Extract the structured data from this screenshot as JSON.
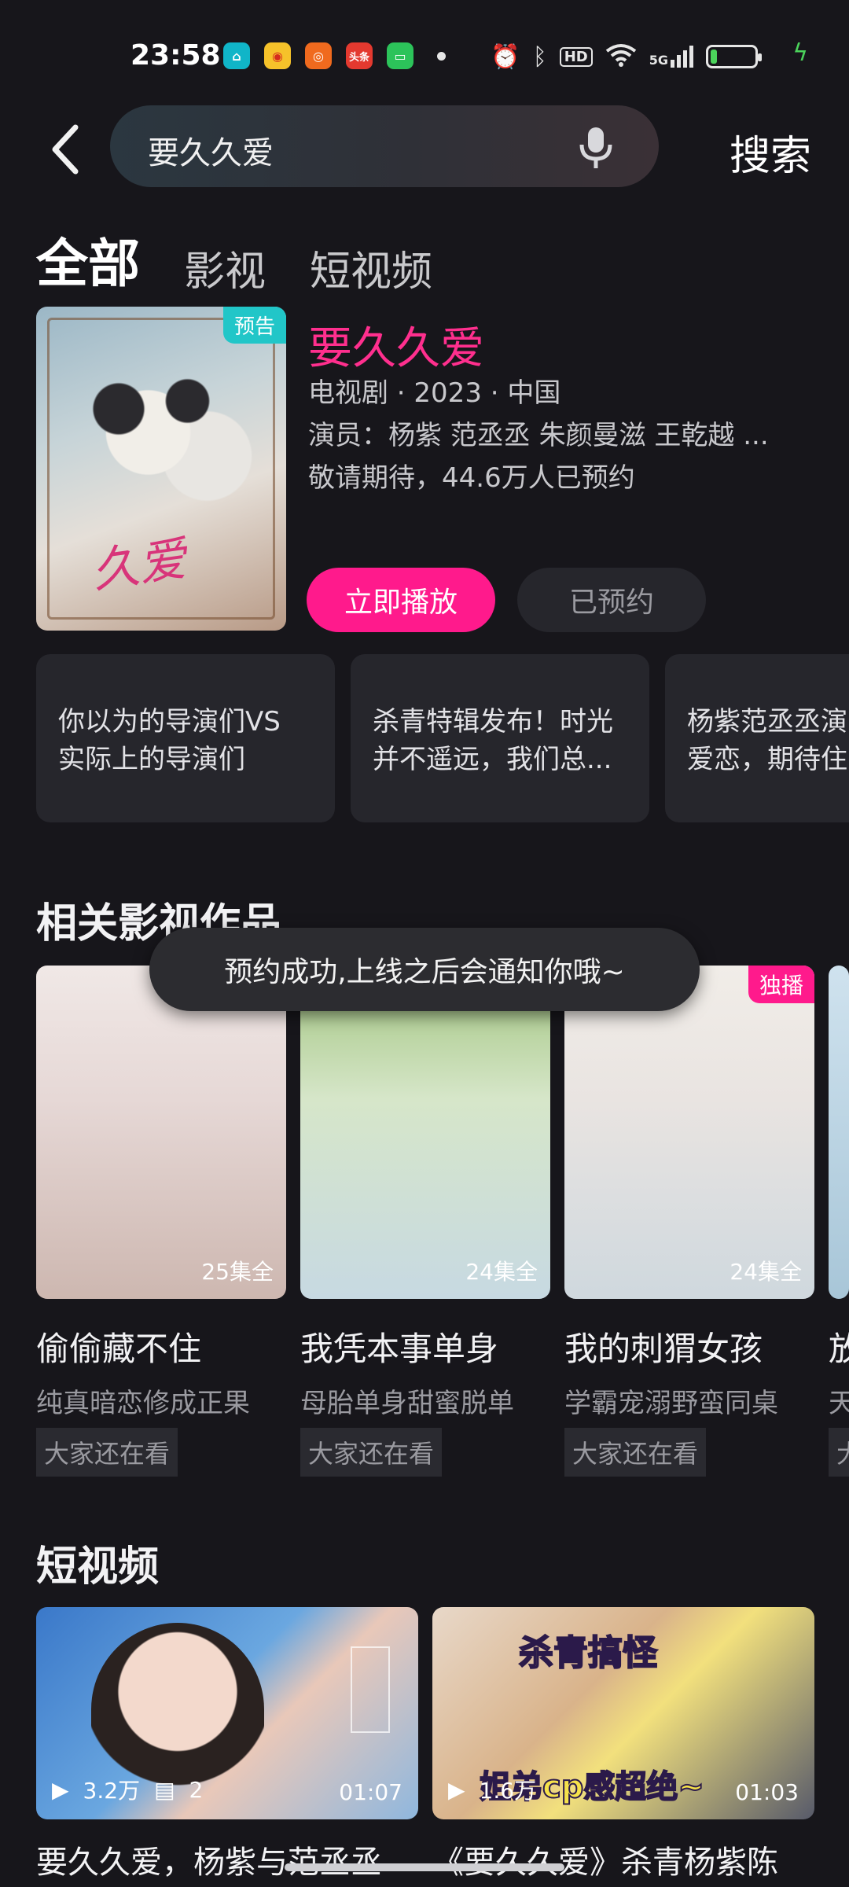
{
  "status_bar": {
    "time": "23:58",
    "apps": [
      "home-app",
      "weibo",
      "app-orange",
      "toutiao",
      "wechat-green"
    ],
    "toutiao_label": "头条",
    "icons": [
      "alarm-icon",
      "bluetooth-icon",
      "hd-icon",
      "wifi-icon",
      "5g-signal-icon",
      "battery-icon",
      "charging-icon"
    ],
    "hd_label": "HD",
    "signal_label": "5G"
  },
  "search": {
    "query": "要久久爱",
    "submit_label": "搜索"
  },
  "tabs": [
    {
      "label": "全部",
      "active": true
    },
    {
      "label": "影视",
      "active": false
    },
    {
      "label": "短视频",
      "active": false
    }
  ],
  "featured": {
    "badge": "预告",
    "title": "要久久爱",
    "meta": "电视剧 · 2023 · 中国",
    "cast": "演员：杨紫 范丞丞 朱颜曼滋 王乾越 ...",
    "status": "敬请期待，44.6万人已预约",
    "play_label": "立即播放",
    "booked_label": "已预约",
    "accent": "#ff1a8c"
  },
  "clips": [
    {
      "line1": "你以为的导演们VS",
      "line2": "实际上的导演们"
    },
    {
      "line1": "杀青特辑发布！时光",
      "line2": "并不遥远，我们总..."
    },
    {
      "line1": "杨紫范丞丞演",
      "line2": "爱恋，期待住"
    }
  ],
  "related_section": {
    "title": "相关影视作品",
    "items": [
      {
        "name": "偷偷藏不住",
        "desc": "纯真暗恋修成正果",
        "episodes": "25集全",
        "tag": "大家还在看"
      },
      {
        "name": "我凭本事单身",
        "desc": "母胎单身甜蜜脱单",
        "episodes": "24集全",
        "tag": "大家还在看"
      },
      {
        "name": "我的刺猬女孩",
        "desc": "学霸宠溺野蛮同桌",
        "episodes": "24集全",
        "tag": "大家还在看",
        "badge": "独播"
      },
      {
        "name": "放",
        "desc": "天",
        "tag": "大"
      }
    ]
  },
  "toast": "预约成功,上线之后会通知你哦~",
  "short_section": {
    "title": "短视频",
    "videos": [
      {
        "views": "3.2万",
        "comments": "2",
        "duration": "01:07",
        "title": "要久久爱，杨紫与范丞丞"
      },
      {
        "views": "1.6万",
        "duration": "01:03",
        "overlay_top": "杀青搞怪",
        "overlay_bottom": "姐弟cp感超绝~",
        "title": "《要久久爱》杀青杨紫陈"
      }
    ]
  }
}
